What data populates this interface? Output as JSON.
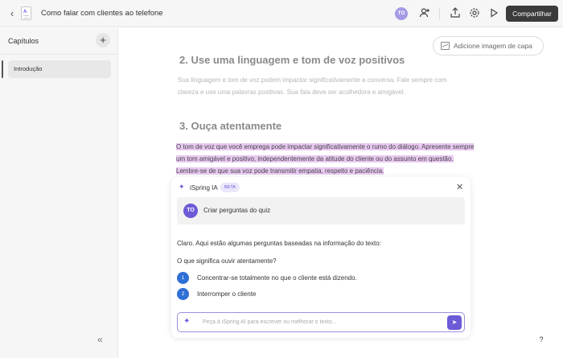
{
  "topbar": {
    "title": "Como falar com clientes ao telefone",
    "doc_glyph": "A",
    "avatar_initials": "TO",
    "share_label": "Compartilhar"
  },
  "sidebar": {
    "title": "Capítulos",
    "items": [
      {
        "label": "Introdução"
      }
    ]
  },
  "main": {
    "cover_label": "Adicione imagem de capa",
    "section2": {
      "heading": "2. Use uma linguagem e tom de voz positivos",
      "text": "Sua linguagem e tom de voz podem impactar significativamente a conversa. Fale sempre com clareza e use uma palavras positivas. Sua fala deve ser acolhedora e amigável."
    },
    "section3": {
      "heading": "3. Ouça atentamente",
      "highlighted_text": "O tom de voz que você emprega pode impactar significativamente o rumo do diálogo. Apresente sempre um tom amigável e positivo, independentemente da atitude do cliente ou do assunto em questão. Lembre-se de que sua voz pode transmitir empatia, respeito e paciência."
    }
  },
  "ai_panel": {
    "name": "iSpring IA",
    "badge": "BETA",
    "user_initials": "TO",
    "prompt": "Criar perguntas do quiz",
    "response_intro": "Claro. Aqui estão algumas perguntas baseadas na informação do texto:",
    "question": "O que significa ouvir atentamente?",
    "options": [
      {
        "num": "1",
        "text": "Concentrar-se totalmente no que o cliente está dizendo."
      },
      {
        "num": "2",
        "text": "Interromper o cliente"
      }
    ],
    "input_placeholder": "Peça à iSpring AI para escrever ou melhorar o texto..."
  },
  "help_label": "?",
  "colors": {
    "accent": "#6b5bd6",
    "highlight": "#e9c9f2",
    "option_badge": "#2f6fd6",
    "share_button": "#3b3b3b"
  }
}
